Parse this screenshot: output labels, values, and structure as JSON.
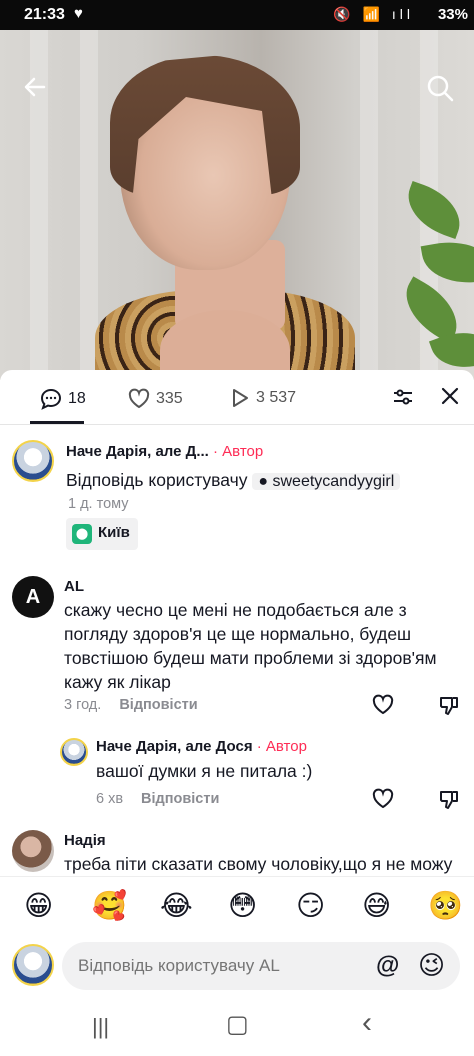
{
  "status_bar": {
    "time": "21:33",
    "battery": "33%",
    "icons": "🔇 📶 ıll"
  },
  "video": {
    "back_icon": "arrow-left-icon",
    "search_icon": "search-icon"
  },
  "stats": {
    "comments": "18",
    "likes": "335",
    "views": "3 537"
  },
  "comments": [
    {
      "author": "Наче Дарія, але Д...",
      "badge": "· Автор",
      "text_prefix": "Відповідь користувачу",
      "mention": "sweetycandyygirl",
      "time": "1 д. тому",
      "location": "Київ"
    },
    {
      "author": "AL",
      "text": "скажу чесно це мені не подобається але з погляду здоров'я це ще нормально, будеш товстішою будеш мати проблеми зі здоров'ям кажу як лікар",
      "time": "3 год.",
      "reply": "Відповісти",
      "avatar_letter": "A"
    },
    {
      "author": "Наче Дарія, але Дося",
      "badge": "· Автор",
      "text": "вашої думки я не питала :)",
      "time": "6 хв",
      "reply": "Відповісти"
    },
    {
      "author": "Надія",
      "text": "треба піти сказати свому чоловіку,що я не можу"
    }
  ],
  "emojis": [
    "😁",
    "🥰",
    "😂",
    "😳",
    "😏",
    "😅",
    "🥺"
  ],
  "input": {
    "placeholder": "Відповідь користувачу AL",
    "at": "@",
    "emoji": "😉"
  },
  "navbar": {
    "recent": "|||",
    "home": "▢",
    "back": "‹"
  }
}
